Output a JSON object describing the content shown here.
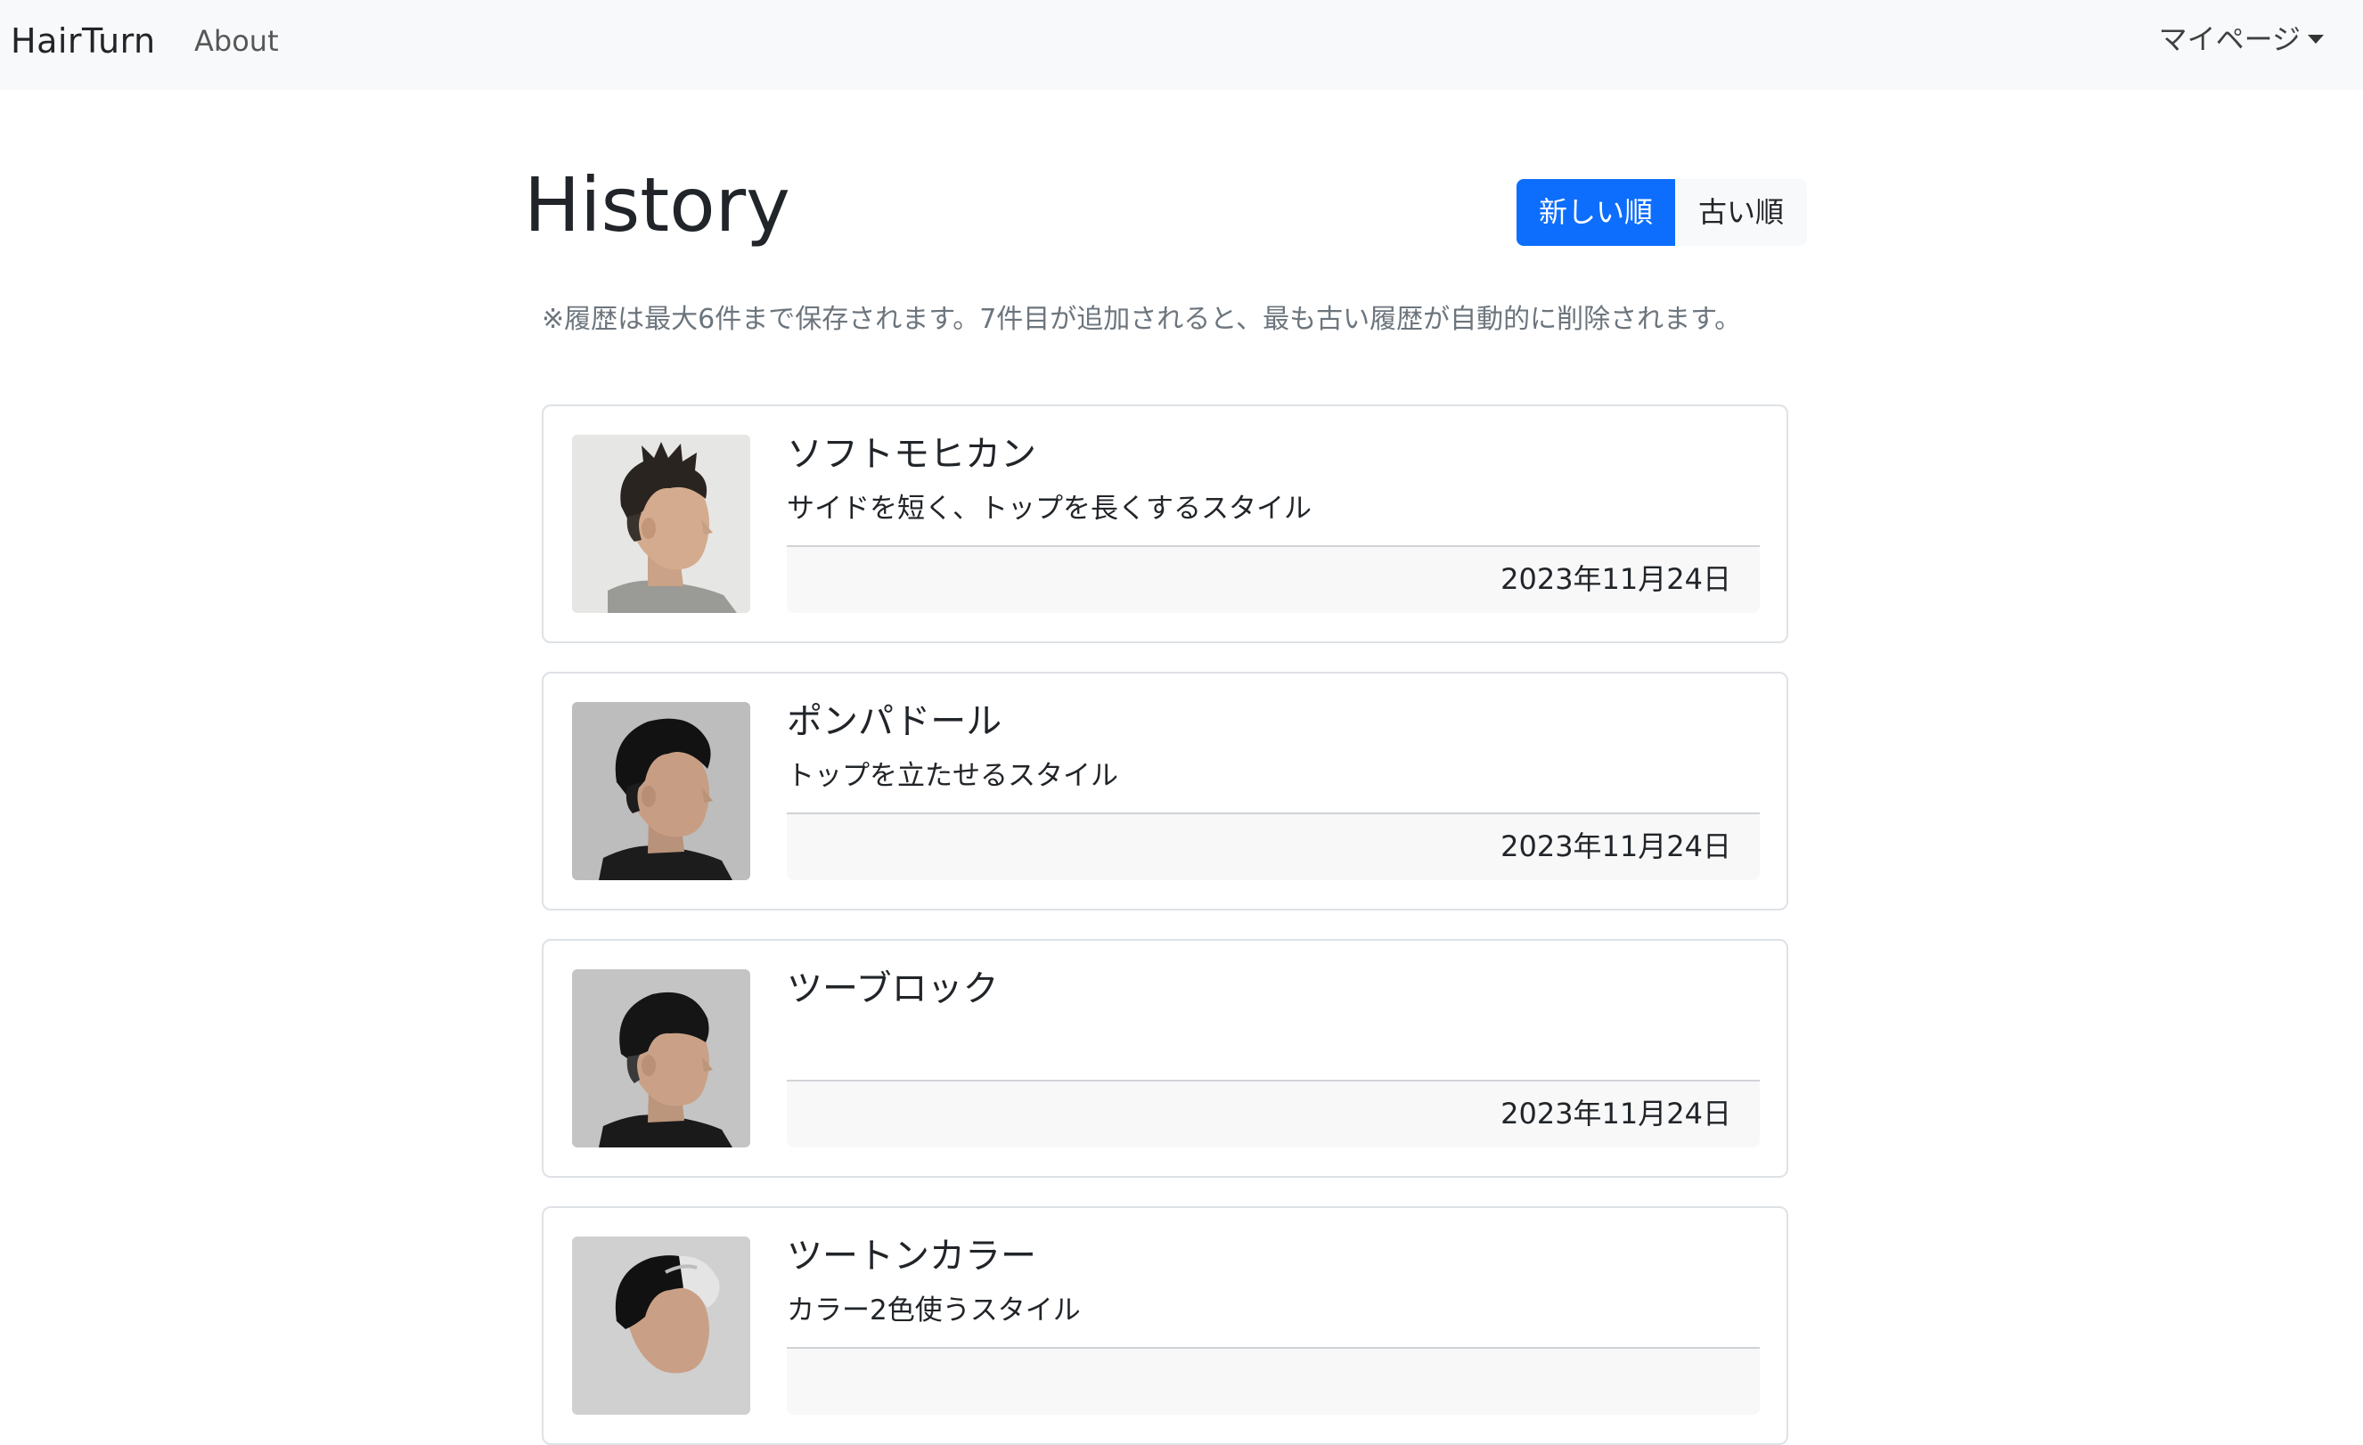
{
  "navbar": {
    "brand": "HairTurn",
    "about": "About",
    "mypage": "マイページ"
  },
  "header": {
    "title": "History",
    "sort_newest": "新しい順",
    "sort_oldest": "古い順",
    "note": "※履歴は最大6件まで保存されます。7件目が追加されると、最も古い履歴が自動的に削除されます。"
  },
  "colors": {
    "accent": "#0d6efd",
    "navbar_bg": "#f8f9fa",
    "border": "#dee2e6",
    "muted": "#6c757d"
  },
  "history": [
    {
      "title": "ソフトモヒカン",
      "description": "サイドを短く、トップを長くするスタイル",
      "date": "2023年11月24日",
      "image": "man-profile-soft-mohawk"
    },
    {
      "title": "ポンパドール",
      "description": "トップを立たせるスタイル",
      "date": "2023年11月24日",
      "image": "man-profile-pompadour"
    },
    {
      "title": "ツーブロック",
      "description": "",
      "date": "2023年11月24日",
      "image": "man-profile-two-block"
    },
    {
      "title": "ツートンカラー",
      "description": "カラー2色使うスタイル",
      "date": "",
      "image": "man-profile-two-tone"
    }
  ]
}
